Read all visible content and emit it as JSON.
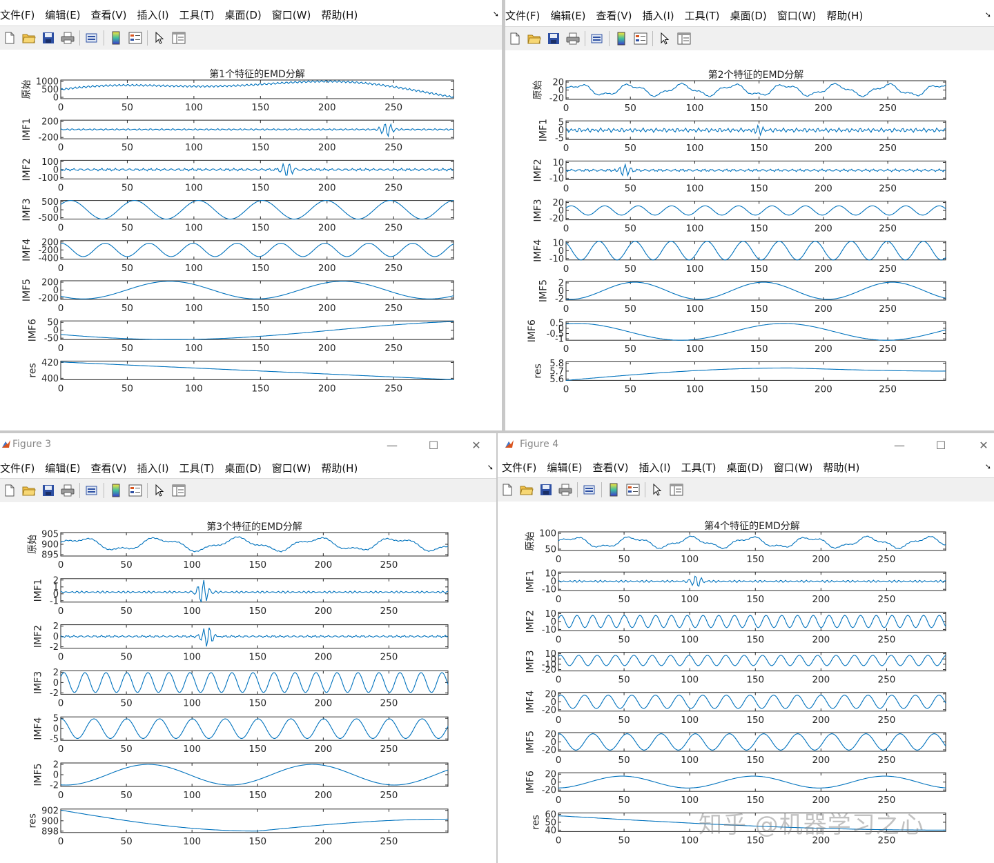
{
  "menu": [
    "文件(F)",
    "编辑(E)",
    "查看(V)",
    "插入(I)",
    "工具(T)",
    "桌面(D)",
    "窗口(W)",
    "帮助(H)"
  ],
  "toolbar_icons": [
    "new-file-icon",
    "open-folder-icon",
    "save-icon",
    "print-icon",
    "print-preview-icon",
    "colorbar-icon",
    "legend-icon",
    "pointer-arrow-icon",
    "property-editor-icon"
  ],
  "window_controls": {
    "minimize": "—",
    "maximize": "☐",
    "close": "✕"
  },
  "windows": [
    {
      "id": "fig1",
      "figure_title": "",
      "plot_title": "第1个特征的EMD分解"
    },
    {
      "id": "fig2",
      "figure_title": "",
      "plot_title": "第2个特征的EMD分解"
    },
    {
      "id": "fig3",
      "figure_title": "Figure 3",
      "plot_title": "第3个特征的EMD分解"
    },
    {
      "id": "fig4",
      "figure_title": "Figure 4",
      "plot_title": "第4个特征的EMD分解"
    }
  ],
  "watermark": "知乎 @机器学习之心",
  "chart_data": [
    {
      "type": "line",
      "title": "第1个特征的EMD分解",
      "line_color": "#0072BD",
      "x_ticks": [
        0,
        50,
        100,
        150,
        200,
        250
      ],
      "xlim": [
        0,
        295
      ],
      "subplots": [
        {
          "ylabel": "原始",
          "yticks": [
            "1000",
            "500",
            "0"
          ],
          "ylim": [
            0,
            1000
          ],
          "shape": "raw",
          "v": [
            300,
            850,
            560
          ]
        },
        {
          "ylabel": "IMF1",
          "yticks": [
            "200",
            "-200"
          ],
          "ylim": [
            -250,
            250
          ],
          "shape": "noise",
          "v": [
            0,
            25,
            0.09,
            1.5,
            245,
            180
          ]
        },
        {
          "ylabel": "IMF2",
          "yticks": [
            "100",
            "0",
            "-100"
          ],
          "ylim": [
            -100,
            100
          ],
          "shape": "noise",
          "v": [
            0,
            15,
            0.25,
            1.2,
            170,
            70
          ]
        },
        {
          "ylabel": "IMF3",
          "yticks": [
            "500",
            "0",
            "-500"
          ],
          "ylim": [
            -500,
            500
          ],
          "shape": "wave",
          "v": [
            0,
            500,
            0.2,
            48
          ]
        },
        {
          "ylabel": "IMF4",
          "yticks": [
            "200",
            "-200",
            "-400"
          ],
          "ylim": [
            -400,
            300
          ],
          "shape": "wave",
          "v": [
            -50,
            250,
            0.5,
            33
          ]
        },
        {
          "ylabel": "IMF5",
          "yticks": [
            "200",
            "0",
            "-200"
          ],
          "ylim": [
            -200,
            200
          ],
          "shape": "wave",
          "v": [
            0,
            190,
            1.3,
            130
          ]
        },
        {
          "ylabel": "IMF6",
          "yticks": [
            "50",
            "0",
            "-50"
          ],
          "ylim": [
            -50,
            50
          ],
          "shape": "wave",
          "v": [
            0,
            50,
            3.3,
            480
          ]
        },
        {
          "ylabel": "res",
          "yticks": [
            "420",
            "400"
          ],
          "ylim": [
            390,
            430
          ],
          "shape": "linear",
          "v": [
            428,
            390
          ]
        }
      ]
    },
    {
      "type": "line",
      "title": "第2个特征的EMD分解",
      "line_color": "#0072BD",
      "x_ticks": [
        0,
        50,
        100,
        150,
        200,
        250
      ],
      "xlim": [
        0,
        295
      ],
      "subplots": [
        {
          "ylabel": "原始",
          "yticks": [
            "20",
            "0",
            "-20"
          ],
          "ylim": [
            -20,
            20
          ],
          "shape": "raw",
          "v": [
            0,
            15,
            40
          ]
        },
        {
          "ylabel": "IMF1",
          "yticks": [
            "5",
            "0",
            "-5"
          ],
          "ylim": [
            -5,
            5
          ],
          "shape": "noise",
          "v": [
            0,
            1.2,
            0.08,
            1.9,
            150,
            2.5
          ]
        },
        {
          "ylabel": "IMF2",
          "yticks": [
            "10",
            "0",
            "-10"
          ],
          "ylim": [
            -10,
            10
          ],
          "shape": "noise",
          "v": [
            0,
            1.5,
            0.3,
            1.1,
            45,
            7
          ]
        },
        {
          "ylabel": "IMF3",
          "yticks": [
            "20",
            "0",
            "-20"
          ],
          "ylim": [
            -20,
            20
          ],
          "shape": "wave",
          "v": [
            0,
            10,
            0.2,
            26
          ]
        },
        {
          "ylabel": "IMF4",
          "yticks": [
            "10",
            "0",
            "-10"
          ],
          "ylim": [
            -10,
            10
          ],
          "shape": "wave",
          "v": [
            0,
            10,
            0.7,
            28
          ]
        },
        {
          "ylabel": "IMF5",
          "yticks": [
            "2",
            "0",
            "-2"
          ],
          "ylim": [
            -2.5,
            2.5
          ],
          "shape": "wave",
          "v": [
            0,
            2.3,
            1.5,
            100
          ]
        },
        {
          "ylabel": "IMF6",
          "yticks": [
            "0.5",
            "0",
            "-0.5",
            "-1"
          ],
          "ylim": [
            -1,
            1
          ],
          "shape": "wave",
          "v": [
            -0.1,
            0.9,
            2.5,
            160
          ]
        },
        {
          "ylabel": "res",
          "yticks": [
            "5.8",
            "5.7",
            "5.6"
          ],
          "ylim": [
            5.55,
            5.85
          ],
          "shape": "hump",
          "v": [
            5.55,
            5.75,
            175,
            5.7
          ]
        }
      ]
    },
    {
      "type": "line",
      "title": "第3个特征的EMD分解",
      "line_color": "#0072BD",
      "x_ticks": [
        0,
        50,
        100,
        150,
        200,
        250
      ],
      "xlim": [
        0,
        295
      ],
      "subplots": [
        {
          "ylabel": "原始",
          "yticks": [
            "905",
            "900",
            "895"
          ],
          "ylim": [
            895,
            907
          ],
          "shape": "raw",
          "v": [
            901,
            4,
            60
          ]
        },
        {
          "ylabel": "IMF1",
          "yticks": [
            "2",
            "1",
            "0",
            "-1"
          ],
          "ylim": [
            -1.5,
            2.5
          ],
          "shape": "noise",
          "v": [
            0.2,
            0.2,
            0.09,
            1.6,
            108,
            2.2
          ]
        },
        {
          "ylabel": "IMF2",
          "yticks": [
            "2",
            "0",
            "-2"
          ],
          "ylim": [
            -2,
            2
          ],
          "shape": "noise",
          "v": [
            0,
            0.2,
            0.2,
            1.2,
            112,
            1.8
          ]
        },
        {
          "ylabel": "IMF3",
          "yticks": [
            "2",
            "0",
            "-2"
          ],
          "ylim": [
            -2,
            2
          ],
          "shape": "wave",
          "v": [
            0,
            1.7,
            0.2,
            16
          ]
        },
        {
          "ylabel": "IMF4",
          "yticks": [
            "5",
            "0",
            "-5"
          ],
          "ylim": [
            -5,
            5
          ],
          "shape": "wave",
          "v": [
            0,
            4.2,
            0.5,
            25
          ]
        },
        {
          "ylabel": "IMF5",
          "yticks": [
            "2",
            "0",
            "-2"
          ],
          "ylim": [
            -2.5,
            2.5
          ],
          "shape": "wave",
          "v": [
            0,
            2.2,
            1.5,
            125
          ]
        },
        {
          "ylabel": "res",
          "yticks": [
            "902",
            "900",
            "898"
          ],
          "ylim": [
            897,
            903.5
          ],
          "shape": "hump",
          "v": [
            903.2,
            897.4,
            150,
            900.7
          ]
        }
      ]
    },
    {
      "type": "line",
      "title": "第4个特征的EMD分解",
      "line_color": "#0072BD",
      "x_ticks": [
        0,
        50,
        100,
        150,
        200,
        250
      ],
      "xlim": [
        0,
        295
      ],
      "subplots": [
        {
          "ylabel": "原始",
          "yticks": [
            "100",
            "50"
          ],
          "ylim": [
            25,
            110
          ],
          "shape": "raw",
          "v": [
            62,
            30,
            45
          ]
        },
        {
          "ylabel": "IMF1",
          "yticks": [
            "10",
            "0",
            "-10"
          ],
          "ylim": [
            -12,
            12
          ],
          "shape": "noise",
          "v": [
            0,
            1.5,
            0.08,
            1.6,
            105,
            9
          ]
        },
        {
          "ylabel": "IMF2",
          "yticks": [
            "10",
            "0",
            "-10"
          ],
          "ylim": [
            -12,
            12
          ],
          "shape": "wave",
          "v": [
            0,
            8,
            0.15,
            12
          ]
        },
        {
          "ylabel": "IMF3",
          "yticks": [
            "10",
            "0",
            "-10",
            "-20"
          ],
          "ylim": [
            -20,
            12
          ],
          "shape": "wave",
          "v": [
            -2,
            9,
            0.3,
            14
          ]
        },
        {
          "ylabel": "IMF4",
          "yticks": [
            "20",
            "0",
            "-20"
          ],
          "ylim": [
            -25,
            25
          ],
          "shape": "wave",
          "v": [
            0,
            18,
            0.3,
            18
          ]
        },
        {
          "ylabel": "IMF5",
          "yticks": [
            "20",
            "0",
            "-20"
          ],
          "ylim": [
            -25,
            25
          ],
          "shape": "wave",
          "v": [
            0,
            22,
            0.5,
            26
          ]
        },
        {
          "ylabel": "IMF6",
          "yticks": [
            "20",
            "0",
            "-20"
          ],
          "ylim": [
            -25,
            25
          ],
          "shape": "wave",
          "v": [
            0,
            16,
            1.6,
            100
          ]
        },
        {
          "ylabel": "res",
          "yticks": [
            "60",
            "50",
            "40"
          ],
          "ylim": [
            38,
            64
          ],
          "shape": "hump",
          "v": [
            60,
            40,
            295,
            62
          ]
        }
      ]
    }
  ]
}
